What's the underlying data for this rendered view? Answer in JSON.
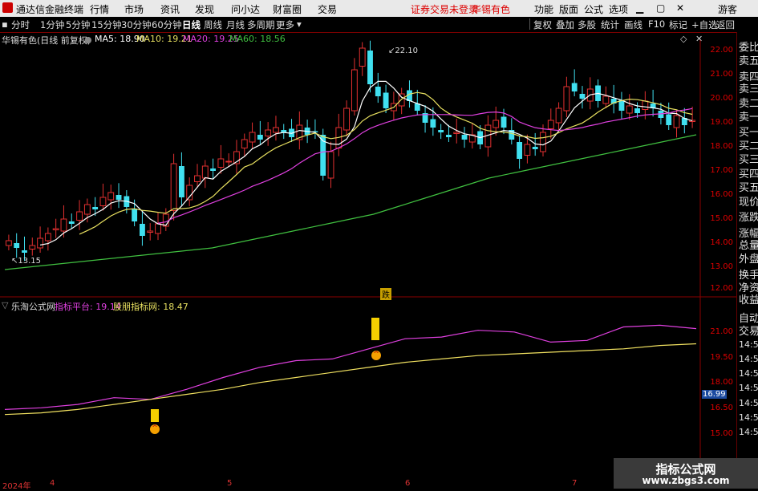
{
  "titlebar": {
    "app_name": "通达信金融终端",
    "menus": [
      "行情",
      "市场",
      "资讯",
      "发现",
      "问小达",
      "财富圈",
      "交易"
    ],
    "notice": "证券交易未登录",
    "stock": "华锡有色",
    "right_items": [
      "功能",
      "版面",
      "公式",
      "选项",
      "游客"
    ]
  },
  "toolbar": {
    "periods": [
      "分时",
      "1分钟",
      "5分钟",
      "15分钟",
      "30分钟",
      "60分钟",
      "日线",
      "周线",
      "月线",
      "多周期",
      "更多"
    ],
    "active": "日线",
    "right_items": [
      "复权",
      "叠加",
      "多股",
      "统计",
      "画线",
      "F10",
      "标记",
      "+自选",
      "返回"
    ]
  },
  "main_chart": {
    "title": "华锡有色(日线 前复权)",
    "ma_labels": [
      {
        "text": "MA5: 18.90",
        "color": "#ffffff"
      },
      {
        "text": "MA10: 19.21",
        "color": "#e8e060"
      },
      {
        "text": "MA20: 19.25",
        "color": "#e040e0"
      },
      {
        "text": "MA60: 18.56",
        "color": "#40c040"
      }
    ],
    "high_label": "22.10",
    "low_label": "13.15",
    "event_label": "跌",
    "y_ticks": [
      "22.00",
      "21.00",
      "20.00",
      "19.00",
      "18.00",
      "17.00",
      "16.00",
      "15.00",
      "14.00",
      "13.00",
      "12.00"
    ]
  },
  "indicator": {
    "title": "乐淘公式网",
    "line1_label": "指标平台: 19.14",
    "line2_label": "股朋指标网: 18.47",
    "current_value": "16.99",
    "y_ticks": [
      "21.00",
      "19.50",
      "18.00",
      "16.50",
      "15.00"
    ]
  },
  "x_axis": {
    "labels": [
      "2024年",
      "4",
      "5",
      "6",
      "7"
    ]
  },
  "sidebar": {
    "items": [
      "委比",
      "卖五",
      "卖四",
      "卖三",
      "卖二",
      "卖一",
      "买一",
      "买二",
      "买三",
      "买四",
      "买五",
      "现价",
      "涨跌",
      "涨幅",
      "总量",
      "外盘",
      "换手",
      "净资",
      "收益",
      "自动",
      "交易",
      "14:56",
      "14:56",
      "14:56",
      "14:56",
      "14:56",
      "14:56",
      "14:56"
    ]
  },
  "watermark": {
    "title": "指标公式网",
    "url": "www.zbgs3.com"
  },
  "chart_data": {
    "type": "candlestick",
    "closes": [
      14.1,
      13.8,
      13.6,
      13.9,
      14.2,
      14.4,
      14.6,
      15.0,
      14.8,
      15.3,
      15.6,
      15.4,
      15.9,
      16.1,
      15.8,
      15.5,
      14.9,
      14.3,
      14.5,
      14.8,
      15.2,
      17.3,
      15.9,
      16.4,
      16.8,
      17.2,
      17.0,
      17.5,
      17.4,
      17.8,
      18.3,
      18.6,
      18.3,
      18.7,
      18.8,
      18.6,
      18.4,
      18.9,
      18.5,
      18.6,
      16.8,
      17.8,
      18.8,
      19.6,
      21.2,
      22.1,
      20.6,
      20.1,
      19.6,
      19.8,
      20.2,
      19.9,
      19.5,
      19.0,
      18.8,
      18.6,
      18.4,
      18.6,
      18.3,
      18.5,
      18.1,
      18.9,
      19.1,
      18.8,
      18.3,
      17.5,
      18.1,
      17.9,
      18.6,
      19.1,
      19.6,
      20.5,
      20.3,
      20.0,
      20.4,
      19.9,
      20.1,
      19.8,
      19.5,
      19.7,
      19.4,
      19.9,
      19.6,
      19.2,
      18.9,
      19.3,
      18.9,
      19.1
    ],
    "ma60": [
      12.9,
      13.0,
      13.1,
      13.2,
      13.3,
      13.4,
      13.5,
      13.6,
      13.7,
      13.8,
      14.0,
      14.2,
      14.4,
      14.6,
      14.8,
      15.0,
      15.2,
      15.5,
      15.8,
      16.1,
      16.4,
      16.7,
      16.9,
      17.1,
      17.3,
      17.5,
      17.7,
      17.9,
      18.1,
      18.3,
      18.5
    ],
    "indicator_line1": [
      14.6,
      14.7,
      14.9,
      15.3,
      15.2,
      15.8,
      16.5,
      17.1,
      17.5,
      17.6,
      18.2,
      18.8,
      18.9,
      19.3,
      19.2,
      18.6,
      18.7,
      19.5,
      19.6,
      19.4
    ],
    "indicator_line2": [
      14.3,
      14.4,
      14.6,
      14.9,
      15.2,
      15.5,
      15.8,
      16.2,
      16.5,
      16.8,
      17.1,
      17.4,
      17.6,
      17.8,
      17.9,
      18.0,
      18.1,
      18.2,
      18.4,
      18.5
    ]
  }
}
